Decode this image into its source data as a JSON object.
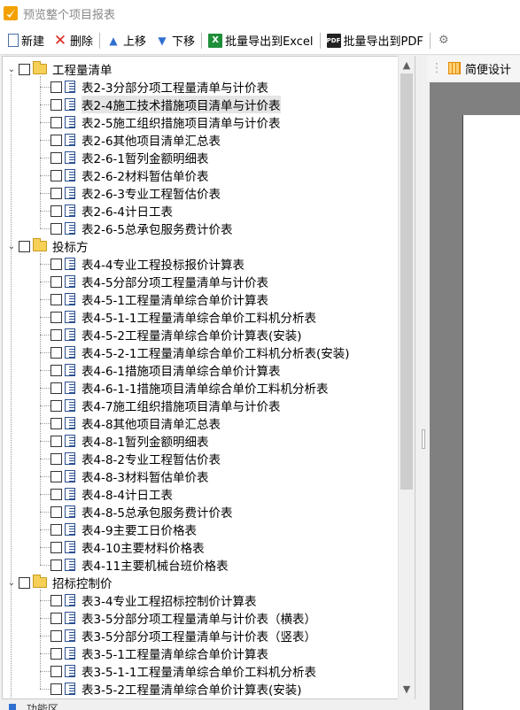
{
  "window": {
    "title": "预览整个项目报表"
  },
  "toolbar": {
    "new_label": "新建",
    "delete_label": "删除",
    "move_up_label": "上移",
    "move_down_label": "下移",
    "export_excel_label": "批量导出到Excel",
    "export_pdf_label": "批量导出到PDF"
  },
  "tree": {
    "groups": [
      {
        "label": "工程量清单",
        "items": [
          "表2-3分部分项工程量清单与计价表",
          "表2-4施工技术措施项目清单与计价表",
          "表2-5施工组织措施项目清单与计价表",
          "表2-6其他项目清单汇总表",
          "表2-6-1暂列金额明细表",
          "表2-6-2材料暂估单价表",
          "表2-6-3专业工程暂估价表",
          "表2-6-4计日工表",
          "表2-6-5总承包服务费计价表"
        ]
      },
      {
        "label": "投标方",
        "items": [
          "表4-4专业工程投标报价计算表",
          "表4-5分部分项工程量清单与计价表",
          "表4-5-1工程量清单综合单价计算表",
          "表4-5-1-1工程量清单综合单价工料机分析表",
          "表4-5-2工程量清单综合单价计算表(安装)",
          "表4-5-2-1工程量清单综合单价工料机分析表(安装)",
          "表4-6-1措施项目清单综合单价计算表",
          "表4-6-1-1措施项目清单综合单价工料机分析表",
          "表4-7施工组织措施项目清单与计价表",
          "表4-8其他项目清单汇总表",
          "表4-8-1暂列金额明细表",
          "表4-8-2专业工程暂估价表",
          "表4-8-3材料暂估单价表",
          "表4-8-4计日工表",
          "表4-8-5总承包服务费计价表",
          "表4-9主要工日价格表",
          "表4-10主要材料价格表",
          "表4-11主要机械台班价格表"
        ]
      },
      {
        "label": "招标控制价",
        "items": [
          "表3-4专业工程招标控制价计算表",
          "表3-5分部分项工程量清单与计价表（横表）",
          "表3-5分部分项工程量清单与计价表（竖表）",
          "表3-5-1工程量清单综合单价计算表",
          "表3-5-1-1工程量清单综合单价工料机分析表",
          "表3-5-2工程量清单综合单价计算表(安装)"
        ]
      }
    ],
    "selected": "表2-4施工技术措施项目清单与计价表"
  },
  "right_panel": {
    "tab_label": "简便设计"
  },
  "bottom": {
    "tab_label": "功能区"
  },
  "icons": {
    "app": "report-app-icon",
    "new": "new-document-icon",
    "delete": "delete-x-icon",
    "up": "arrow-up-icon",
    "down": "arrow-down-icon",
    "excel": "excel-icon",
    "pdf": "pdf-icon",
    "folder": "folder-icon",
    "document": "document-icon"
  },
  "colors": {
    "delete": "#e0261f",
    "arrows": "#2f6fd0",
    "excel": "#1f8f3a",
    "folder": "#f6cf57",
    "preview_bg": "#808080"
  }
}
